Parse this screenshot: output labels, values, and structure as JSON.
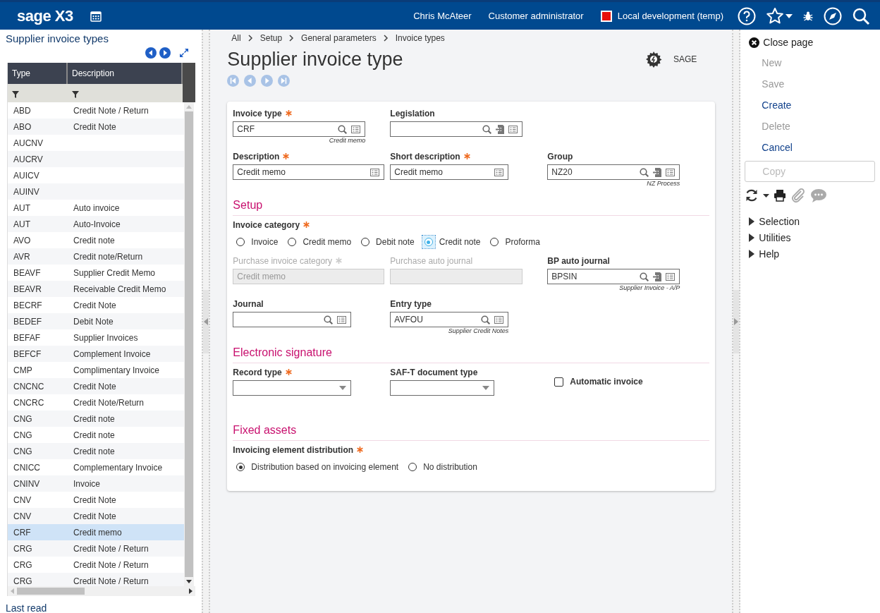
{
  "header": {
    "logo": "sage X3",
    "user": "Chris McAteer",
    "role": "Customer administrator",
    "environment": {
      "label": "Local development (temp)",
      "color": "#e8120c"
    }
  },
  "left_panel": {
    "title": "Supplier invoice types",
    "columns": [
      "Type",
      "Description"
    ],
    "rows": [
      {
        "type": "ABD",
        "description": "Credit Note / Return",
        "selected": false
      },
      {
        "type": "ABO",
        "description": "Credit Note",
        "selected": false
      },
      {
        "type": "AUCNV",
        "description": "",
        "selected": false
      },
      {
        "type": "AUCRV",
        "description": "",
        "selected": false
      },
      {
        "type": "AUICV",
        "description": "",
        "selected": false
      },
      {
        "type": "AUINV",
        "description": "",
        "selected": false
      },
      {
        "type": "AUT",
        "description": "Auto invoice",
        "selected": false
      },
      {
        "type": "AUT",
        "description": "Auto-Invoice",
        "selected": false
      },
      {
        "type": "AVO",
        "description": "Credit note",
        "selected": false
      },
      {
        "type": "AVR",
        "description": "Credit note/Return",
        "selected": false
      },
      {
        "type": "BEAVF",
        "description": "Supplier Credit Memo",
        "selected": false
      },
      {
        "type": "BEAVR",
        "description": "Receivable Credit Memo",
        "selected": false
      },
      {
        "type": "BECRF",
        "description": "Credit Note",
        "selected": false
      },
      {
        "type": "BEDEF",
        "description": "Debit Note",
        "selected": false
      },
      {
        "type": "BEFAF",
        "description": "Supplier Invoices",
        "selected": false
      },
      {
        "type": "BEFCF",
        "description": "Complement Invoice",
        "selected": false
      },
      {
        "type": "CMP",
        "description": "Complimentary Invoice",
        "selected": false
      },
      {
        "type": "CNCNC",
        "description": "Credit Note",
        "selected": false
      },
      {
        "type": "CNCRC",
        "description": "Credit Note/Return",
        "selected": false
      },
      {
        "type": "CNG",
        "description": "Credit note",
        "selected": false
      },
      {
        "type": "CNG",
        "description": "Credit note",
        "selected": false
      },
      {
        "type": "CNG",
        "description": "Credit note",
        "selected": false
      },
      {
        "type": "CNICC",
        "description": "Complementary Invoice",
        "selected": false
      },
      {
        "type": "CNINV",
        "description": "Invoice",
        "selected": false
      },
      {
        "type": "CNV",
        "description": "Credit Note",
        "selected": false
      },
      {
        "type": "CNV",
        "description": "Credit Note",
        "selected": false
      },
      {
        "type": "CRF",
        "description": "Credit memo",
        "selected": true
      },
      {
        "type": "CRG",
        "description": "Credit Note / Return",
        "selected": false
      },
      {
        "type": "CRG",
        "description": "Credit Note / Return",
        "selected": false
      },
      {
        "type": "CRG",
        "description": "Credit Note / Return",
        "selected": false
      }
    ],
    "footer": "Last read"
  },
  "breadcrumb": [
    "All",
    "Setup",
    "General parameters",
    "Invoice types"
  ],
  "page": {
    "title": "Supplier invoice type",
    "folder": "SAGE"
  },
  "sections": [
    {
      "rows": [
        [
          {
            "kind": "lookup",
            "label": "Invoice type",
            "required": true,
            "disabled": false,
            "value": "CRF",
            "hint": "Credit memo"
          },
          {
            "kind": "lookup-jump",
            "label": "Legislation",
            "required": false,
            "disabled": false
          }
        ],
        [
          {
            "kind": "text",
            "label": "Description",
            "required": true,
            "disabled": false,
            "value": "Credit memo"
          },
          {
            "kind": "text",
            "label": "Short description",
            "required": true,
            "disabled": false,
            "value": "Credit memo"
          },
          {
            "kind": "lookup-jump",
            "label": "Group",
            "required": false,
            "disabled": false,
            "value": "NZ20",
            "hint": "NZ Process"
          }
        ]
      ]
    },
    {
      "title": "Setup",
      "rows": [
        [
          {
            "kind": "radio",
            "label": "Invoice category",
            "required": true,
            "options": [
              {
                "label": "Invoice",
                "selected": false
              },
              {
                "label": "Credit memo",
                "selected": false
              },
              {
                "label": "Debit note",
                "selected": false
              },
              {
                "label": "Credit note",
                "selected": true
              },
              {
                "label": "Proforma",
                "selected": false
              }
            ]
          }
        ],
        [
          {
            "kind": "plain",
            "label": "Purchase invoice category",
            "required": true,
            "disabled": true,
            "value": "Credit memo"
          },
          {
            "kind": "plain",
            "label": "Purchase auto journal",
            "required": false,
            "disabled": true
          },
          {
            "kind": "lookup-jump",
            "label": "BP auto journal",
            "required": false,
            "disabled": false,
            "value": "BPSIN",
            "hint": "Supplier Invoice - A/P"
          }
        ],
        [
          {
            "kind": "lookup",
            "label": "Journal",
            "required": false,
            "disabled": false
          },
          {
            "kind": "lookup",
            "label": "Entry type",
            "required": false,
            "disabled": false,
            "value": "AVFOU",
            "hint": "Supplier Credit Notes"
          }
        ]
      ]
    },
    {
      "title": "Electronic signature",
      "rows": [
        [
          {
            "kind": "select",
            "label": "Record type",
            "required": true,
            "disabled": false
          },
          {
            "kind": "select",
            "label": "SAF-T document type",
            "required": false,
            "disabled": false
          },
          {
            "kind": "checkbox",
            "label": "Automatic invoice",
            "checked": false
          }
        ]
      ]
    },
    {
      "title": "Fixed assets",
      "rows": [
        [
          {
            "kind": "radio",
            "label": "Invoicing element distribution",
            "required": true,
            "options": [
              {
                "label": "Distribution based on invoicing element",
                "selected": true
              },
              {
                "label": "No distribution",
                "selected": false
              }
            ]
          }
        ]
      ]
    }
  ],
  "right_panel": {
    "close": "Close page",
    "actions": [
      {
        "label": "New",
        "disabled": true
      },
      {
        "label": "Save",
        "disabled": true
      },
      {
        "label": "Create",
        "disabled": false
      },
      {
        "label": "Delete",
        "disabled": true
      },
      {
        "label": "Cancel",
        "disabled": false
      }
    ],
    "copy": {
      "label": "Copy",
      "disabled": true
    },
    "menus": [
      {
        "label": "Selection",
        "expanded": false
      },
      {
        "label": "Utilities",
        "expanded": false
      },
      {
        "label": "Help",
        "expanded": false
      }
    ]
  }
}
